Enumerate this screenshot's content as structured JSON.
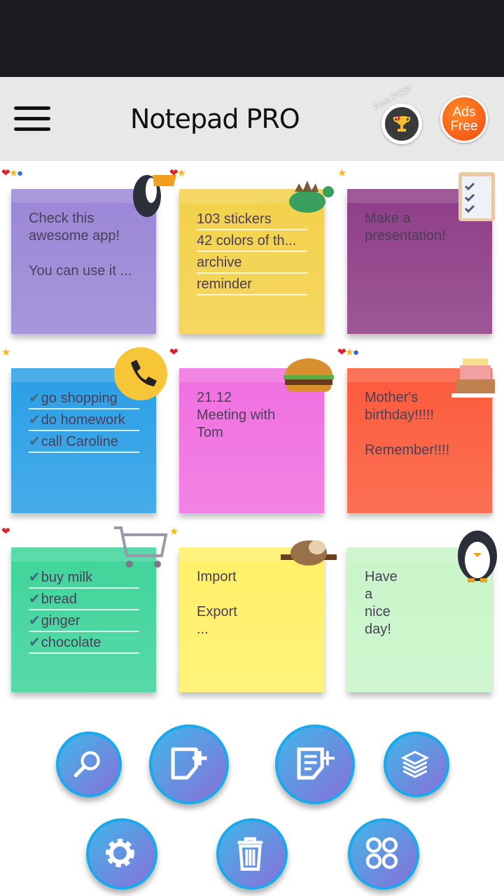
{
  "app": {
    "title": "Notepad PRO",
    "free_prize": "Free Prize",
    "ads_free_line1": "Ads",
    "ads_free_line2": "Free"
  },
  "notes": [
    {
      "color": "#9a86d6",
      "lines": [
        "Check this",
        "awesome app!",
        "",
        "You can use it ..."
      ],
      "badges": [
        "heart",
        "star",
        "bell"
      ],
      "sticker": "toucan",
      "lined": false
    },
    {
      "color": "#f3d14a",
      "lines": [
        "103 stickers",
        "42 colors of th...",
        "archive",
        "reminder"
      ],
      "badges": [
        "heart",
        "star"
      ],
      "sticker": "dinosaur",
      "lined": true
    },
    {
      "color": "#8e3d86",
      "lines": [
        "Make a",
        "presentation!"
      ],
      "badges": [
        "star"
      ],
      "sticker": "clipboard",
      "lined": false
    },
    {
      "color": "#2a9fe6",
      "lines": [
        "go shopping",
        "do homework",
        "call Caroline"
      ],
      "checked": true,
      "badges": [
        "star"
      ],
      "sticker": "phone",
      "lined": true
    },
    {
      "color": "#f06fe0",
      "lines": [
        "21.12",
        "Meeting with",
        "Tom"
      ],
      "badges": [
        "heart"
      ],
      "sticker": "burger",
      "lined": false
    },
    {
      "color": "#fb5a3a",
      "lines": [
        "Mother's",
        "birthday!!!!!",
        "",
        "Remember!!!!"
      ],
      "badges": [
        "heart",
        "star",
        "bell"
      ],
      "sticker": "cake",
      "lined": false
    },
    {
      "color": "#3ed49a",
      "lines": [
        "buy milk",
        "bread",
        "ginger",
        "chocolate"
      ],
      "checked": true,
      "badges": [
        "heart"
      ],
      "sticker": "cart",
      "lined": true
    },
    {
      "color": "#fff066",
      "lines": [
        "Import",
        "",
        "Export",
        "..."
      ],
      "badges": [
        "star"
      ],
      "sticker": "sloth",
      "lined": false
    },
    {
      "color": "#c8f5c8",
      "lines": [
        "Have",
        "a",
        "nice",
        "day!"
      ],
      "badges": [],
      "sticker": "penguin",
      "lined": false
    }
  ],
  "toolbar": [
    {
      "name": "search",
      "icon": "search-icon"
    },
    {
      "name": "new-note",
      "icon": "new-note-icon"
    },
    {
      "name": "new-list",
      "icon": "new-list-icon"
    },
    {
      "name": "layers",
      "icon": "layers-icon"
    },
    {
      "name": "settings",
      "icon": "gear-icon"
    },
    {
      "name": "trash",
      "icon": "trash-icon"
    },
    {
      "name": "apps",
      "icon": "apps-icon"
    }
  ]
}
